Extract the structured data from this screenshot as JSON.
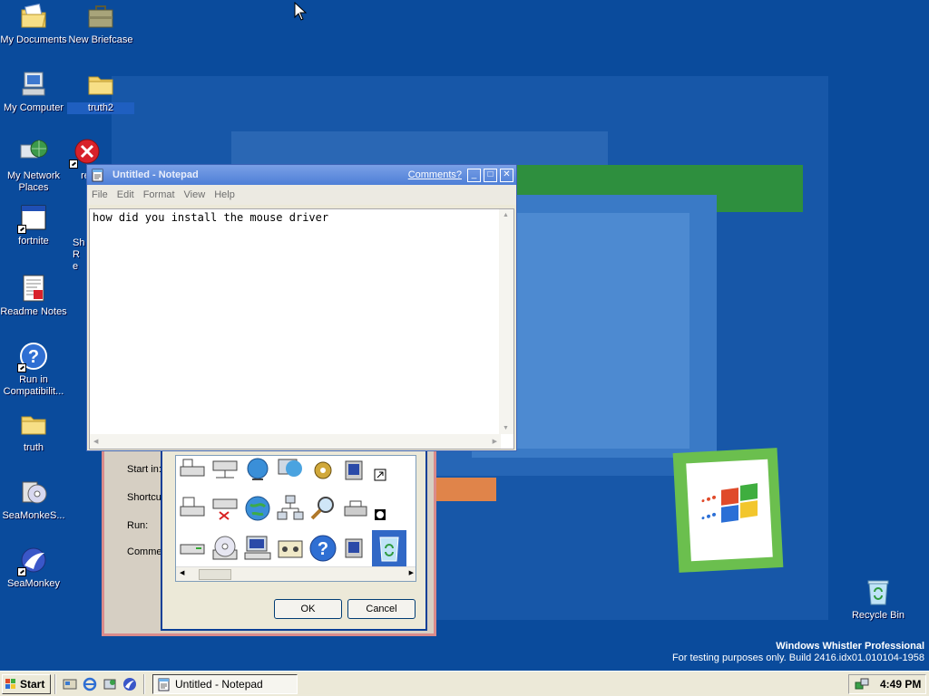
{
  "desktop": {
    "icons": [
      {
        "label": "My Documents"
      },
      {
        "label": "New Briefcase"
      },
      {
        "label": "My Computer"
      },
      {
        "label": "truth2"
      },
      {
        "label": "My Network Places"
      },
      {
        "label": "re"
      },
      {
        "label": "fortnite"
      },
      {
        "label": "Sh Re"
      },
      {
        "label": "Readme Notes"
      },
      {
        "label": "Run in Compatibilit..."
      },
      {
        "label": "truth"
      },
      {
        "label": "SeaMonkeS..."
      },
      {
        "label": "SeaMonkey"
      },
      {
        "label": "Recycle Bin"
      }
    ],
    "watermark": {
      "line1": "Windows Whistler Professional",
      "line2": "For testing purposes only. Build 2416.idx01.010104-1958"
    }
  },
  "properties_dialog": {
    "labels": [
      "Start in:",
      "Shortcu",
      "Run:",
      "Commen"
    ],
    "ok_label": "OK",
    "cancel_label": "Cancel"
  },
  "notepad": {
    "title": "Untitled - Notepad",
    "comments_link": "Comments?",
    "menu": [
      "File",
      "Edit",
      "Format",
      "View",
      "Help"
    ],
    "content": "how did you install the mouse driver"
  },
  "taskbar": {
    "start_label": "Start",
    "task_label": "Untitled - Notepad",
    "clock": "4:49 PM"
  },
  "colors": {
    "desktop": "#0a4b9c",
    "titlebar": "#4e7fd7",
    "taskbar": "#ece9d8"
  }
}
